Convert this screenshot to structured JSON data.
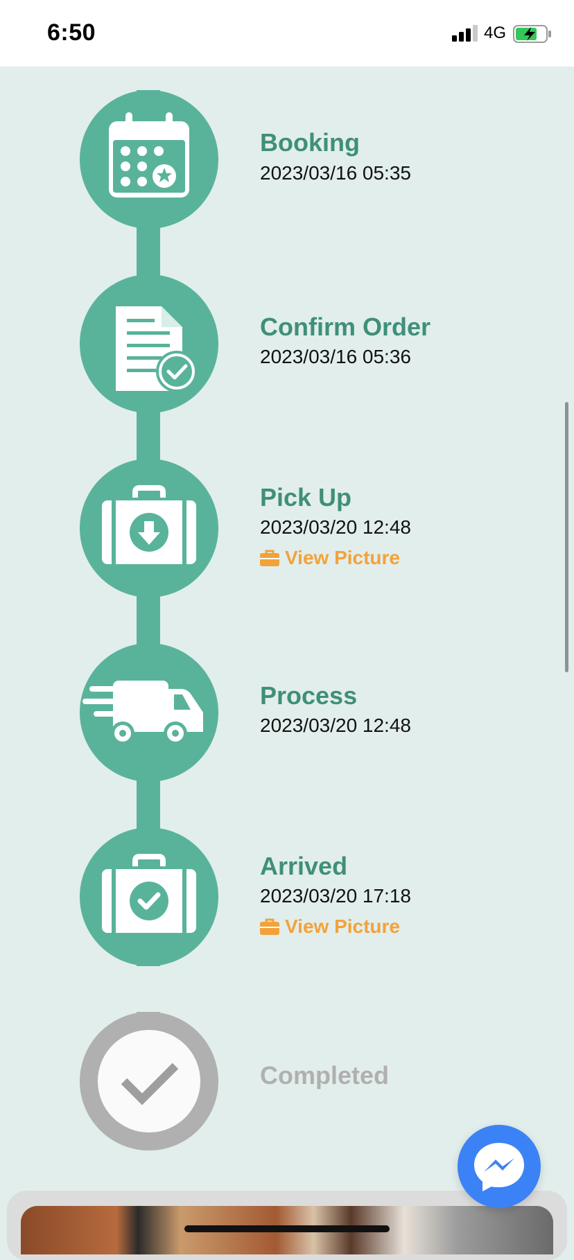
{
  "status_bar": {
    "time": "6:50",
    "network": "4G"
  },
  "steps": [
    {
      "title": "Booking",
      "date": "2023/03/16 05:35",
      "icon": "calendar-icon",
      "active": true
    },
    {
      "title": "Confirm Order",
      "date": "2023/03/16 05:36",
      "icon": "document-check-icon",
      "active": true
    },
    {
      "title": "Pick Up",
      "date": "2023/03/20 12:48",
      "link": "View Picture",
      "icon": "suitcase-download-icon",
      "active": true
    },
    {
      "title": "Process",
      "date": "2023/03/20 12:48",
      "icon": "truck-icon",
      "active": true
    },
    {
      "title": "Arrived",
      "date": "2023/03/20 17:18",
      "link": "View Picture",
      "icon": "suitcase-check-icon",
      "active": true
    },
    {
      "title": "Completed",
      "icon": "checkmark-icon",
      "active": false
    }
  ],
  "colors": {
    "active": "#59b39b",
    "title": "#3f8f7a",
    "link": "#f2a23a",
    "inactive": "#b0b0b0",
    "background": "#e2eeeb",
    "messenger": "#3b82f6"
  }
}
